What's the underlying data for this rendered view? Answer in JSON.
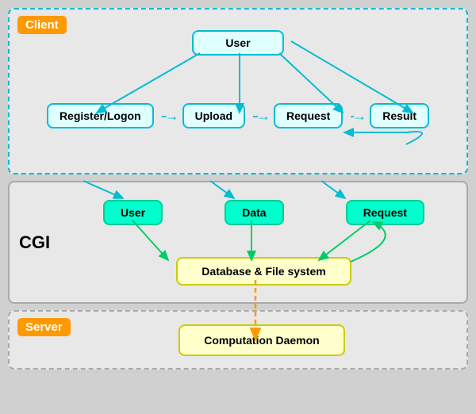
{
  "sections": {
    "client": {
      "label": "Client",
      "user_box": "User",
      "boxes": [
        "Register/Logon",
        "Upload",
        "Request",
        "Result"
      ]
    },
    "cgi": {
      "label": "CGI",
      "boxes": [
        "User",
        "Data",
        "Request"
      ],
      "db_box": "Database & File system"
    },
    "server": {
      "label": "Server",
      "daemon_box": "Computation Daemon"
    }
  }
}
